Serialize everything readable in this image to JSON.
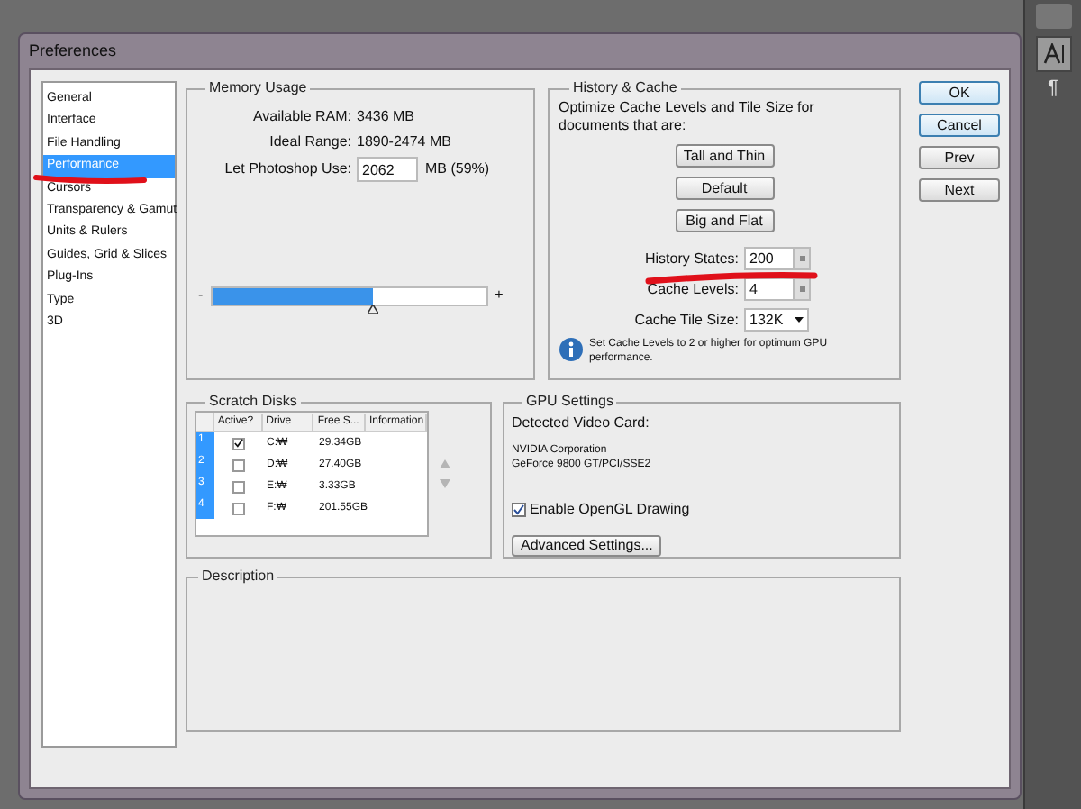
{
  "window": {
    "title": "Preferences"
  },
  "sidebar": {
    "items": [
      {
        "label": "General",
        "selected": false
      },
      {
        "label": "Interface",
        "selected": false
      },
      {
        "label": "File Handling",
        "selected": false
      },
      {
        "label": "Performance",
        "selected": true
      },
      {
        "label": "Cursors",
        "selected": false
      },
      {
        "label": "Transparency & Gamut",
        "selected": false
      },
      {
        "label": "Units & Rulers",
        "selected": false
      },
      {
        "label": "Guides, Grid & Slices",
        "selected": false
      },
      {
        "label": "Plug-Ins",
        "selected": false
      },
      {
        "label": "Type",
        "selected": false
      },
      {
        "label": "3D",
        "selected": false
      }
    ]
  },
  "memory_usage": {
    "title": "Memory Usage",
    "available_ram_label": "Available RAM:",
    "available_ram": "3436 MB",
    "ideal_range_label": "Ideal Range:",
    "ideal_range": "1890-2474 MB",
    "use_label": "Let Photoshop Use:",
    "use_value": "2062",
    "use_unit": "MB (59%)",
    "slider": {
      "minus": "-",
      "plus": "+",
      "level": 0.59
    }
  },
  "history_cache": {
    "title": "History & Cache",
    "intro": "Optimize Cache Levels and Tile Size for documents that are:",
    "presets": [
      "Tall and Thin",
      "Default",
      "Big and Flat"
    ],
    "history_states_label": "History States:",
    "history_states": "200",
    "cache_levels_label": "Cache Levels:",
    "cache_levels": "4",
    "tile_size_label": "Cache Tile Size:",
    "tile_size": "132K",
    "note": "Set Cache Levels to 2 or higher for optimum GPU performance."
  },
  "dialog_buttons": [
    {
      "label": "OK",
      "kind": "default"
    },
    {
      "label": "Cancel",
      "kind": "default"
    },
    {
      "label": "Prev",
      "kind": "normal"
    },
    {
      "label": "Next",
      "kind": "normal"
    }
  ],
  "scratch_disks": {
    "title": "Scratch Disks",
    "columns": [
      "Active?",
      "Drive",
      "Free S...",
      "Information"
    ],
    "rows": [
      {
        "index": "1",
        "active": true,
        "drive": "C:₩",
        "free": "29.34GB"
      },
      {
        "index": "2",
        "active": false,
        "drive": "D:₩",
        "free": "27.40GB"
      },
      {
        "index": "3",
        "active": false,
        "drive": "E:₩",
        "free": "3.33GB"
      },
      {
        "index": "4",
        "active": false,
        "drive": "F:₩",
        "free": "201.55GB"
      }
    ]
  },
  "gpu_settings": {
    "title": "GPU Settings",
    "detected_label": "Detected Video Card:",
    "card_lines": [
      "NVIDIA Corporation",
      "GeForce 9800 GT/PCI/SSE2"
    ],
    "opengl": {
      "label": "Enable OpenGL Drawing",
      "checked": true
    },
    "advanced_button": "Advanced Settings..."
  },
  "description": {
    "title": "Description"
  },
  "side_panel": {
    "paragraph_glyph": "¶"
  }
}
